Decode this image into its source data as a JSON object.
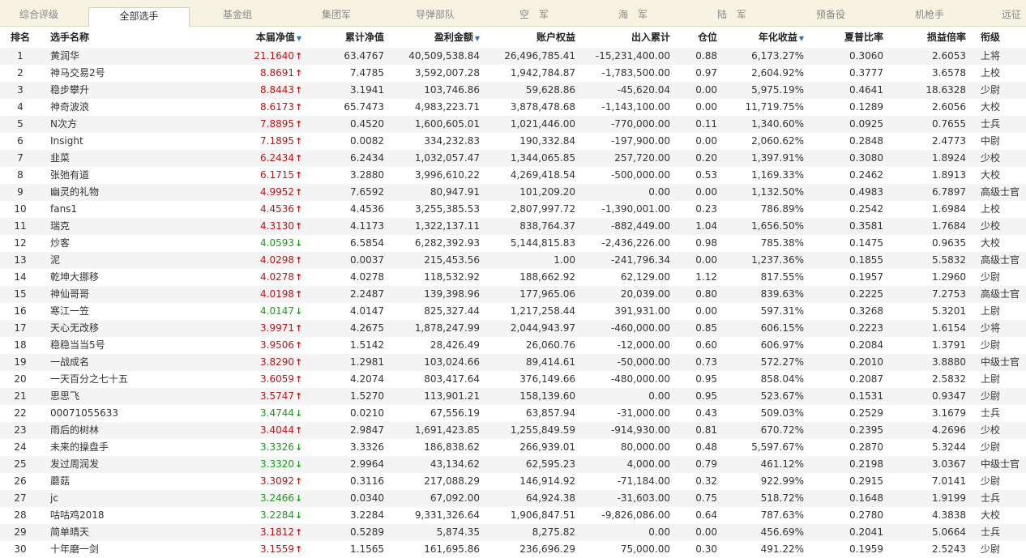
{
  "tabs": [
    {
      "label": "综合评级"
    },
    {
      "label": "全部选手",
      "active": true
    },
    {
      "label": "基金组"
    },
    {
      "label": "集团军"
    },
    {
      "label": "导弹部队"
    },
    {
      "label": "空　军"
    },
    {
      "label": "海　军"
    },
    {
      "label": "陆　军"
    },
    {
      "label": "预备役"
    },
    {
      "label": "机枪手"
    },
    {
      "label": "远征"
    }
  ],
  "headers": {
    "rank": "排名",
    "name": "选手名称",
    "nav": "本届净值",
    "cum_nav": "累计净值",
    "profit": "盈利金额",
    "equity": "账户权益",
    "inout": "出入累计",
    "position": "仓位",
    "annual": "年化收益",
    "sharpe": "夏普比率",
    "pl_ratio": "损益倍率",
    "title": "衔级"
  },
  "sort_icon": "▼",
  "colors": {
    "up": "#b51818",
    "down": "#1a9a1a",
    "sort": "#2b6fd6"
  },
  "rows": [
    {
      "rank": "1",
      "name": "黄润华",
      "nav": "21.1640",
      "dir": "up",
      "cum_nav": "63.4767",
      "profit": "40,509,538.84",
      "equity": "26,496,785.41",
      "inout": "-15,231,400.00",
      "position": "0.88",
      "annual": "6,173.27%",
      "sharpe": "0.3060",
      "pl_ratio": "2.6053",
      "title": "上将"
    },
    {
      "rank": "2",
      "name": "神马交易2号",
      "nav": "8.8691",
      "dir": "up",
      "cum_nav": "7.4785",
      "profit": "3,592,007.28",
      "equity": "1,942,784.87",
      "inout": "-1,783,500.00",
      "position": "0.97",
      "annual": "2,604.92%",
      "sharpe": "0.3777",
      "pl_ratio": "3.6578",
      "title": "上校"
    },
    {
      "rank": "3",
      "name": "稳步攀升",
      "nav": "8.8443",
      "dir": "up",
      "cum_nav": "3.1941",
      "profit": "103,746.86",
      "equity": "59,628.86",
      "inout": "-45,620.04",
      "position": "0.00",
      "annual": "5,975.19%",
      "sharpe": "0.4641",
      "pl_ratio": "18.6328",
      "title": "少尉"
    },
    {
      "rank": "4",
      "name": "神奇波浪",
      "nav": "8.6173",
      "dir": "up",
      "cum_nav": "65.7473",
      "profit": "4,983,223.71",
      "equity": "3,878,478.68",
      "inout": "-1,143,100.00",
      "position": "0.00",
      "annual": "11,719.75%",
      "sharpe": "0.1289",
      "pl_ratio": "2.6056",
      "title": "大校"
    },
    {
      "rank": "5",
      "name": "N次方",
      "nav": "7.8895",
      "dir": "up",
      "cum_nav": "0.4520",
      "profit": "1,600,605.01",
      "equity": "1,021,446.00",
      "inout": "-770,000.00",
      "position": "0.11",
      "annual": "1,340.60%",
      "sharpe": "0.0925",
      "pl_ratio": "0.7655",
      "title": "士兵"
    },
    {
      "rank": "6",
      "name": "Insight",
      "nav": "7.1895",
      "dir": "up",
      "cum_nav": "0.0082",
      "profit": "334,232.83",
      "equity": "190,332.84",
      "inout": "-197,900.00",
      "position": "0.00",
      "annual": "2,060.62%",
      "sharpe": "0.2848",
      "pl_ratio": "2.4773",
      "title": "中尉"
    },
    {
      "rank": "7",
      "name": "韭菜",
      "nav": "6.2434",
      "dir": "up",
      "cum_nav": "6.2434",
      "profit": "1,032,057.47",
      "equity": "1,344,065.85",
      "inout": "257,720.00",
      "position": "0.20",
      "annual": "1,397.91%",
      "sharpe": "0.3080",
      "pl_ratio": "1.8924",
      "title": "少校"
    },
    {
      "rank": "8",
      "name": "张弛有道",
      "nav": "6.1715",
      "dir": "up",
      "cum_nav": "3.2880",
      "profit": "3,996,610.22",
      "equity": "4,269,418.54",
      "inout": "-500,000.00",
      "position": "0.53",
      "annual": "1,169.33%",
      "sharpe": "0.2462",
      "pl_ratio": "1.8913",
      "title": "大校"
    },
    {
      "rank": "9",
      "name": "幽灵的礼物",
      "nav": "4.9952",
      "dir": "up",
      "cum_nav": "7.6592",
      "profit": "80,947.91",
      "equity": "101,209.20",
      "inout": "0.00",
      "position": "0.00",
      "annual": "1,132.50%",
      "sharpe": "0.4983",
      "pl_ratio": "6.7897",
      "title": "高级士官"
    },
    {
      "rank": "10",
      "name": "fans1",
      "nav": "4.4536",
      "dir": "up",
      "cum_nav": "4.4536",
      "profit": "3,255,385.53",
      "equity": "2,807,997.72",
      "inout": "-1,390,001.00",
      "position": "0.23",
      "annual": "786.89%",
      "sharpe": "0.2542",
      "pl_ratio": "1.6984",
      "title": "上校"
    },
    {
      "rank": "11",
      "name": "瑞克",
      "nav": "4.3130",
      "dir": "up",
      "cum_nav": "4.1173",
      "profit": "1,322,137.11",
      "equity": "838,764.37",
      "inout": "-882,449.00",
      "position": "1.04",
      "annual": "1,656.50%",
      "sharpe": "0.3581",
      "pl_ratio": "1.7684",
      "title": "少校"
    },
    {
      "rank": "12",
      "name": "炒客",
      "nav": "4.0593",
      "dir": "down",
      "cum_nav": "6.5854",
      "profit": "6,282,392.93",
      "equity": "5,144,815.83",
      "inout": "-2,436,226.00",
      "position": "0.98",
      "annual": "785.38%",
      "sharpe": "0.1475",
      "pl_ratio": "0.9635",
      "title": "大校"
    },
    {
      "rank": "13",
      "name": "泥",
      "nav": "4.0298",
      "dir": "up",
      "cum_nav": "0.0037",
      "profit": "215,453.56",
      "equity": "1.00",
      "inout": "-241,796.34",
      "position": "0.00",
      "annual": "1,237.36%",
      "sharpe": "0.1855",
      "pl_ratio": "5.5832",
      "title": "高级士官"
    },
    {
      "rank": "14",
      "name": "乾坤大挪移",
      "nav": "4.0278",
      "dir": "up",
      "cum_nav": "4.0278",
      "profit": "118,532.92",
      "equity": "188,662.92",
      "inout": "62,129.00",
      "position": "1.12",
      "annual": "817.55%",
      "sharpe": "0.1957",
      "pl_ratio": "1.2960",
      "title": "少尉"
    },
    {
      "rank": "15",
      "name": "神仙哥哥",
      "nav": "4.0198",
      "dir": "up",
      "cum_nav": "2.2487",
      "profit": "139,398.96",
      "equity": "177,965.06",
      "inout": "20,039.00",
      "position": "0.80",
      "annual": "839.63%",
      "sharpe": "0.2225",
      "pl_ratio": "7.2753",
      "title": "高级士官"
    },
    {
      "rank": "16",
      "name": "寒江一笠",
      "nav": "4.0147",
      "dir": "down",
      "cum_nav": "4.0147",
      "profit": "825,327.44",
      "equity": "1,217,258.44",
      "inout": "391,931.00",
      "position": "0.00",
      "annual": "597.31%",
      "sharpe": "0.3268",
      "pl_ratio": "5.3201",
      "title": "上尉"
    },
    {
      "rank": "17",
      "name": "天心无改移",
      "nav": "3.9971",
      "dir": "up",
      "cum_nav": "4.2675",
      "profit": "1,878,247.99",
      "equity": "2,044,943.97",
      "inout": "-460,000.00",
      "position": "0.85",
      "annual": "606.15%",
      "sharpe": "0.2223",
      "pl_ratio": "1.6154",
      "title": "少将"
    },
    {
      "rank": "18",
      "name": "稳稳当当5号",
      "nav": "3.9506",
      "dir": "up",
      "cum_nav": "1.5142",
      "profit": "28,426.49",
      "equity": "26,060.76",
      "inout": "-12,000.00",
      "position": "0.60",
      "annual": "606.97%",
      "sharpe": "0.2084",
      "pl_ratio": "1.3791",
      "title": "少尉"
    },
    {
      "rank": "19",
      "name": "一战成名",
      "nav": "3.8290",
      "dir": "up",
      "cum_nav": "1.2981",
      "profit": "103,024.66",
      "equity": "89,414.61",
      "inout": "-50,000.00",
      "position": "0.73",
      "annual": "572.27%",
      "sharpe": "0.2010",
      "pl_ratio": "3.8880",
      "title": "中级士官"
    },
    {
      "rank": "20",
      "name": "一天百分之七十五",
      "nav": "3.6059",
      "dir": "up",
      "cum_nav": "4.2074",
      "profit": "803,417.64",
      "equity": "376,149.66",
      "inout": "-480,000.00",
      "position": "0.95",
      "annual": "858.04%",
      "sharpe": "0.2087",
      "pl_ratio": "2.5832",
      "title": "上尉"
    },
    {
      "rank": "21",
      "name": "思思飞",
      "nav": "3.5747",
      "dir": "up",
      "cum_nav": "1.5270",
      "profit": "113,901.21",
      "equity": "158,139.60",
      "inout": "0.00",
      "position": "0.95",
      "annual": "523.67%",
      "sharpe": "0.1531",
      "pl_ratio": "0.9347",
      "title": "少尉"
    },
    {
      "rank": "22",
      "name": "00071055633",
      "nav": "3.4744",
      "dir": "down",
      "cum_nav": "0.0210",
      "profit": "67,556.19",
      "equity": "63,857.94",
      "inout": "-31,000.00",
      "position": "0.43",
      "annual": "509.03%",
      "sharpe": "0.2529",
      "pl_ratio": "3.1679",
      "title": "士兵"
    },
    {
      "rank": "23",
      "name": "雨后的树林",
      "nav": "3.4044",
      "dir": "up",
      "cum_nav": "2.9847",
      "profit": "1,691,423.85",
      "equity": "1,255,849.59",
      "inout": "-914,930.00",
      "position": "0.81",
      "annual": "670.72%",
      "sharpe": "0.2395",
      "pl_ratio": "4.2696",
      "title": "少校"
    },
    {
      "rank": "24",
      "name": "未来的操盘手",
      "nav": "3.3326",
      "dir": "down",
      "cum_nav": "3.3326",
      "profit": "186,838.62",
      "equity": "266,939.01",
      "inout": "80,000.00",
      "position": "0.48",
      "annual": "5,597.67%",
      "sharpe": "0.2870",
      "pl_ratio": "5.3244",
      "title": "少尉"
    },
    {
      "rank": "25",
      "name": "发过周润发",
      "nav": "3.3320",
      "dir": "down",
      "cum_nav": "2.9964",
      "profit": "43,134.62",
      "equity": "62,595.23",
      "inout": "4,000.00",
      "position": "0.79",
      "annual": "461.12%",
      "sharpe": "0.2198",
      "pl_ratio": "3.0367",
      "title": "中级士官"
    },
    {
      "rank": "26",
      "name": "蘑菇",
      "nav": "3.3092",
      "dir": "up",
      "cum_nav": "0.3116",
      "profit": "217,088.29",
      "equity": "146,914.92",
      "inout": "-71,184.00",
      "position": "0.32",
      "annual": "922.99%",
      "sharpe": "0.2915",
      "pl_ratio": "7.0141",
      "title": "少尉"
    },
    {
      "rank": "27",
      "name": "jc",
      "nav": "3.2466",
      "dir": "down",
      "cum_nav": "0.0340",
      "profit": "67,092.00",
      "equity": "64,924.38",
      "inout": "-31,603.00",
      "position": "0.75",
      "annual": "518.72%",
      "sharpe": "0.1648",
      "pl_ratio": "1.9199",
      "title": "士兵"
    },
    {
      "rank": "28",
      "name": "咕咕鸡2018",
      "nav": "3.2284",
      "dir": "down",
      "cum_nav": "3.2284",
      "profit": "9,331,326.64",
      "equity": "1,906,847.51",
      "inout": "-9,826,086.00",
      "position": "0.64",
      "annual": "787.63%",
      "sharpe": "0.2780",
      "pl_ratio": "4.3838",
      "title": "大校"
    },
    {
      "rank": "29",
      "name": "简单晴天",
      "nav": "3.1812",
      "dir": "up",
      "cum_nav": "0.5289",
      "profit": "5,874.35",
      "equity": "8,275.82",
      "inout": "0.00",
      "position": "0.00",
      "annual": "456.69%",
      "sharpe": "0.2041",
      "pl_ratio": "5.0664",
      "title": "士兵"
    },
    {
      "rank": "30",
      "name": "十年磨一剑",
      "nav": "3.1559",
      "dir": "up",
      "cum_nav": "1.1565",
      "profit": "161,695.86",
      "equity": "236,696.29",
      "inout": "75,000.00",
      "position": "0.30",
      "annual": "491.22%",
      "sharpe": "0.1959",
      "pl_ratio": "2.5243",
      "title": "少尉"
    }
  ]
}
